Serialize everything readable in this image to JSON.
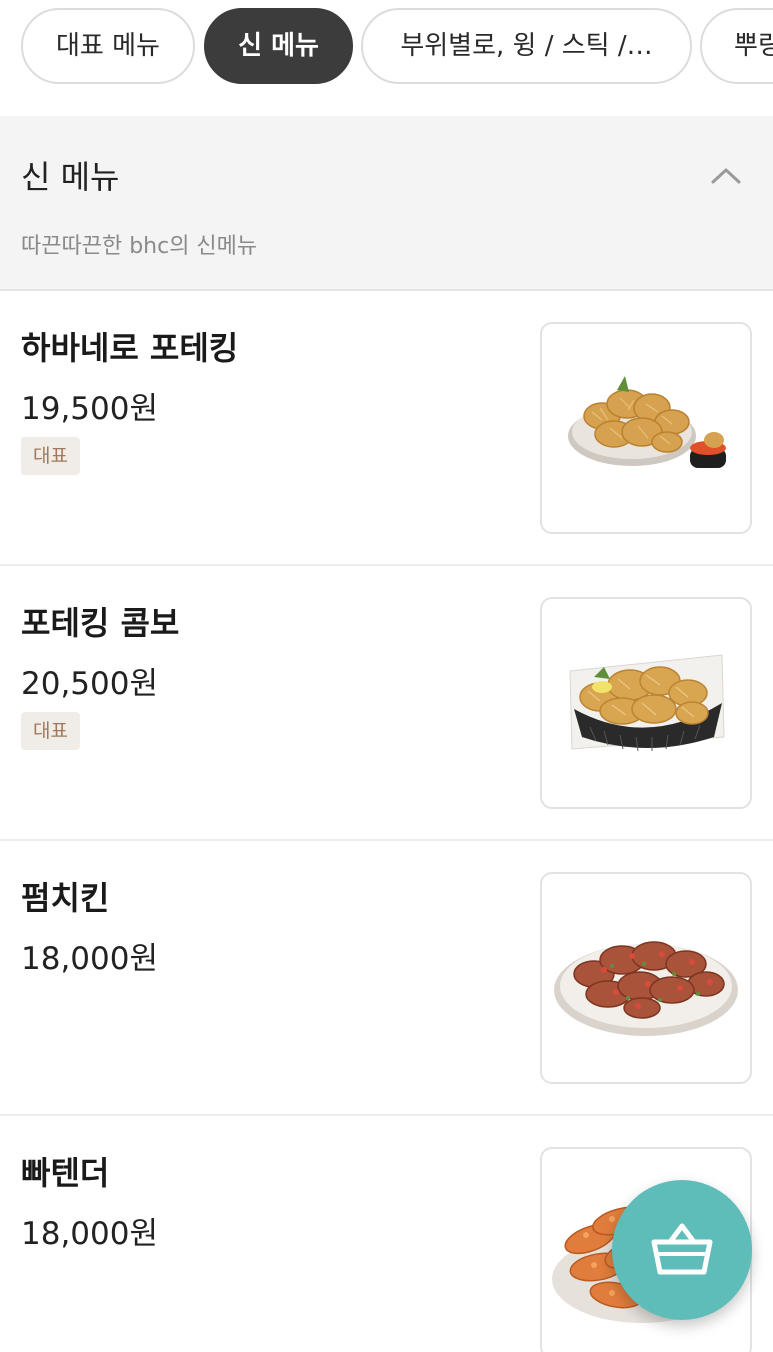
{
  "tabs": [
    {
      "label": "대표 메뉴"
    },
    {
      "label": "신 메뉴"
    },
    {
      "label": "부위별로, 윙 / 스틱 /…"
    },
    {
      "label": "뿌링"
    }
  ],
  "section": {
    "title": "신 메뉴",
    "description": "따끈따끈한 bhc의 신메뉴"
  },
  "items": [
    {
      "name": "하바네로 포테킹",
      "price": "19,500원",
      "badge": "대표"
    },
    {
      "name": "포테킹 콤보",
      "price": "20,500원",
      "badge": "대표"
    },
    {
      "name": "펌치킨",
      "price": "18,000원"
    },
    {
      "name": "빠텐더",
      "price": "18,000원"
    }
  ],
  "colors": {
    "active_tab": "#3c3c3c",
    "badge_bg": "#f0ede9",
    "badge_text": "#a0785a",
    "cart_button": "#5fbdb9"
  },
  "icons": {
    "collapse": "chevron-up-icon",
    "cart": "shopping-basket-icon"
  }
}
